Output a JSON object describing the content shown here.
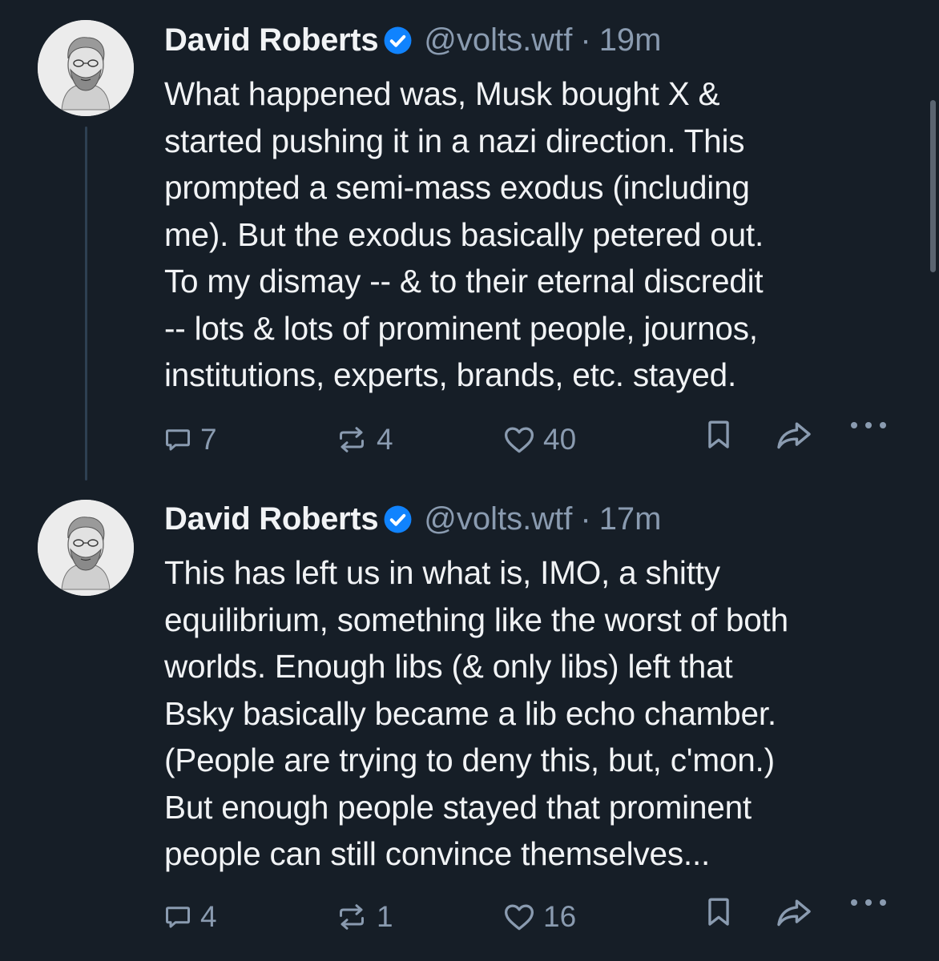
{
  "posts": [
    {
      "author": "David Roberts",
      "handle": "@volts.wtf",
      "separator": "·",
      "time": "19m",
      "text": "What happened was, Musk bought X &\nstarted pushing it in a nazi direction. This\nprompted a semi-mass exodus (including\nme). But the exodus basically petered out.\nTo my dismay -- & to their eternal discredit\n-- lots & lots of prominent people, journos,\ninstitutions, experts, brands, etc. stayed.",
      "replies": "7",
      "reposts": "4",
      "likes": "40"
    },
    {
      "author": "David Roberts",
      "handle": "@volts.wtf",
      "separator": "·",
      "time": "17m",
      "text": "This has left us in what is, IMO, a shitty\nequilibrium, something like the worst of both\nworlds. Enough libs (& only libs) left that\nBsky basically became a lib echo chamber.\n(People are trying to deny this, but, c'mon.)\nBut enough people stayed that prominent\npeople can still convince themselves...",
      "replies": "4",
      "reposts": "1",
      "likes": "16"
    }
  ],
  "icons": {
    "reply": "speech-bubble-icon",
    "repost": "repost-arrows-icon",
    "like": "heart-icon",
    "bookmark": "bookmark-icon",
    "share": "share-arrow-icon",
    "more": "ellipsis-icon",
    "verified": "verified-check-icon"
  },
  "colors": {
    "background": "#161e27",
    "text": "#f1f3f5",
    "muted": "#8a9bb0",
    "verified": "#1083fe",
    "thread_line": "#2e4052"
  }
}
